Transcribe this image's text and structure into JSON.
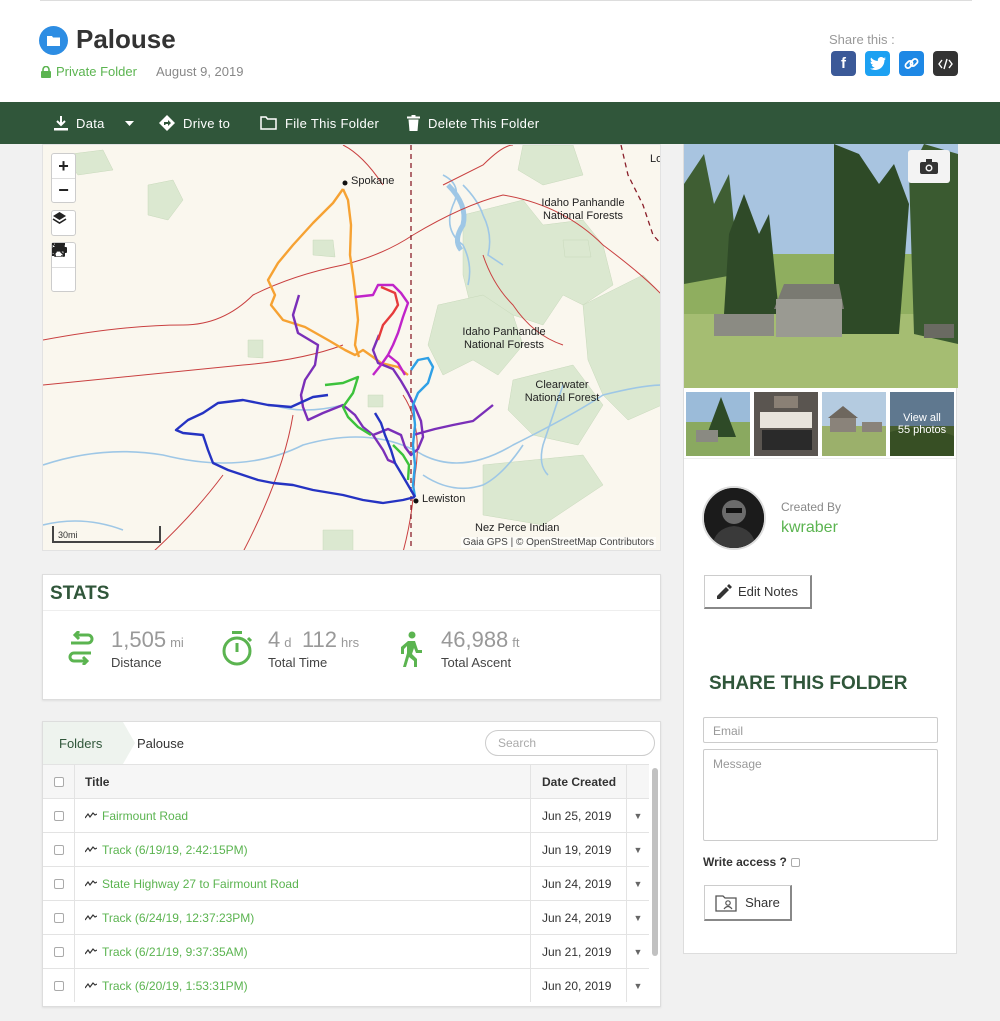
{
  "header": {
    "title": "Palouse",
    "privacy": "Private Folder",
    "date": "August 9, 2019",
    "share_label": "Share this :"
  },
  "toolbar": {
    "data": "Data",
    "drive_to": "Drive to",
    "file_folder": "File This Folder",
    "delete_folder": "Delete This Folder"
  },
  "map": {
    "places": {
      "spokane": "Spokane",
      "idaho_panhandle_1": "Idaho Panhandle\nNational Forests",
      "idaho_panhandle_2": "Idaho Panhandle\nNational Forests",
      "clearwater": "Clearwater\nNational Forest",
      "lewiston": "Lewiston",
      "nez_perce": "Nez Perce Indian",
      "lo": "Lo"
    },
    "attribution": "Gaia GPS | © OpenStreetMap Contributors",
    "scale": "30mi",
    "controls": {
      "zoom_in": "+",
      "zoom_out": "−"
    }
  },
  "stats": {
    "title": "STATS",
    "distance": {
      "value": "1,505",
      "unit": "mi",
      "label": "Distance"
    },
    "time": {
      "days": "4",
      "days_unit": "d",
      "hours": "112",
      "hours_unit": "hrs",
      "label": "Total Time"
    },
    "ascent": {
      "value": "46,988",
      "unit": "ft",
      "label": "Total Ascent"
    }
  },
  "table": {
    "crumbs": {
      "folders": "Folders",
      "current": "Palouse"
    },
    "search_placeholder": "Search",
    "columns": {
      "title": "Title",
      "date": "Date Created"
    },
    "rows": [
      {
        "title": "Fairmount Road",
        "date": "Jun 25, 2019"
      },
      {
        "title": "Track (6/19/19, 2:42:15PM)",
        "date": "Jun 19, 2019"
      },
      {
        "title": "State Highway 27 to Fairmount Road",
        "date": "Jun 24, 2019"
      },
      {
        "title": "Track (6/24/19, 12:37:23PM)",
        "date": "Jun 24, 2019"
      },
      {
        "title": "Track (6/21/19, 9:37:35AM)",
        "date": "Jun 21, 2019"
      },
      {
        "title": "Track (6/20/19, 1:53:31PM)",
        "date": "Jun 20, 2019"
      }
    ]
  },
  "sidebar": {
    "view_all": "View all",
    "photo_count": "55 photos",
    "created_by": "Created By",
    "creator": "kwraber",
    "edit_notes": "Edit Notes",
    "share_title": "SHARE THIS FOLDER",
    "email_placeholder": "Email",
    "message_placeholder": "Message",
    "write_access": "Write access ?",
    "share_button": "Share"
  },
  "colors": {
    "brand_green": "#30563a",
    "link_green": "#5bb450",
    "folder_blue": "#2d8de3",
    "facebook": "#3b5998",
    "twitter": "#1da1f2",
    "link": "#1e88e5",
    "embed": "#333333"
  }
}
